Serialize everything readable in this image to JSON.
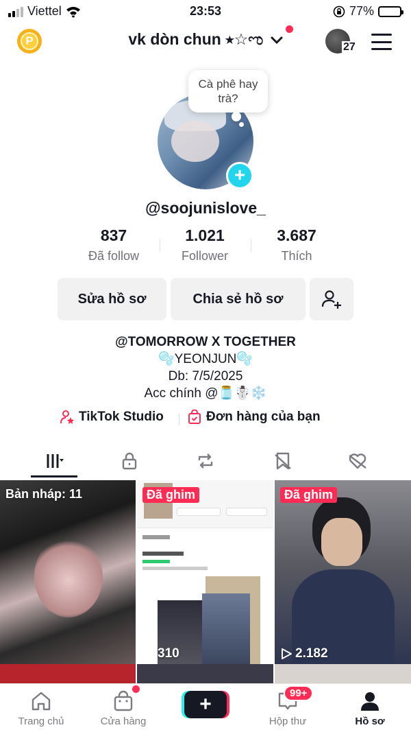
{
  "status_bar": {
    "carrier": "Viettel",
    "time": "23:53",
    "battery": "77%",
    "battery_level": 0.77
  },
  "header": {
    "username": "vk dòn chun ⭒☆ಌ",
    "friend_count": "27"
  },
  "profile": {
    "bubble_text": "Cà phê hay trà?",
    "handle": "@soojunislove_",
    "stats": [
      {
        "value": "837",
        "label": "Đã follow"
      },
      {
        "value": "1.021",
        "label": "Follower"
      },
      {
        "value": "3.687",
        "label": "Thích"
      }
    ],
    "buttons": {
      "edit": "Sửa hồ sơ",
      "share": "Chia sẻ hồ sơ"
    },
    "bio": [
      "@TOMORROW X TOGETHER",
      "🫧YEONJUN🫧",
      "Db: 7/5/2025",
      "Acc chính @🫙☃️❄️"
    ],
    "links": {
      "studio": "TikTok Studio",
      "orders": "Đơn hàng của bạn"
    }
  },
  "tabs": [
    "videos-icon",
    "lock-icon",
    "repost-icon",
    "favorites-icon",
    "liked-icon"
  ],
  "grid": [
    {
      "label": "Bản nháp: 11",
      "views": ""
    },
    {
      "pin": "Đã ghim",
      "views": "310"
    },
    {
      "pin": "Đã ghim",
      "views": "2.182"
    }
  ],
  "bottom_nav": {
    "home": "Trang chủ",
    "shop": "Cửa hàng",
    "inbox": "Hộp thư",
    "inbox_badge": "99+",
    "profile": "Hồ sơ"
  },
  "colors": {
    "accent": "#fe2c55",
    "cyan": "#20d5ec"
  }
}
